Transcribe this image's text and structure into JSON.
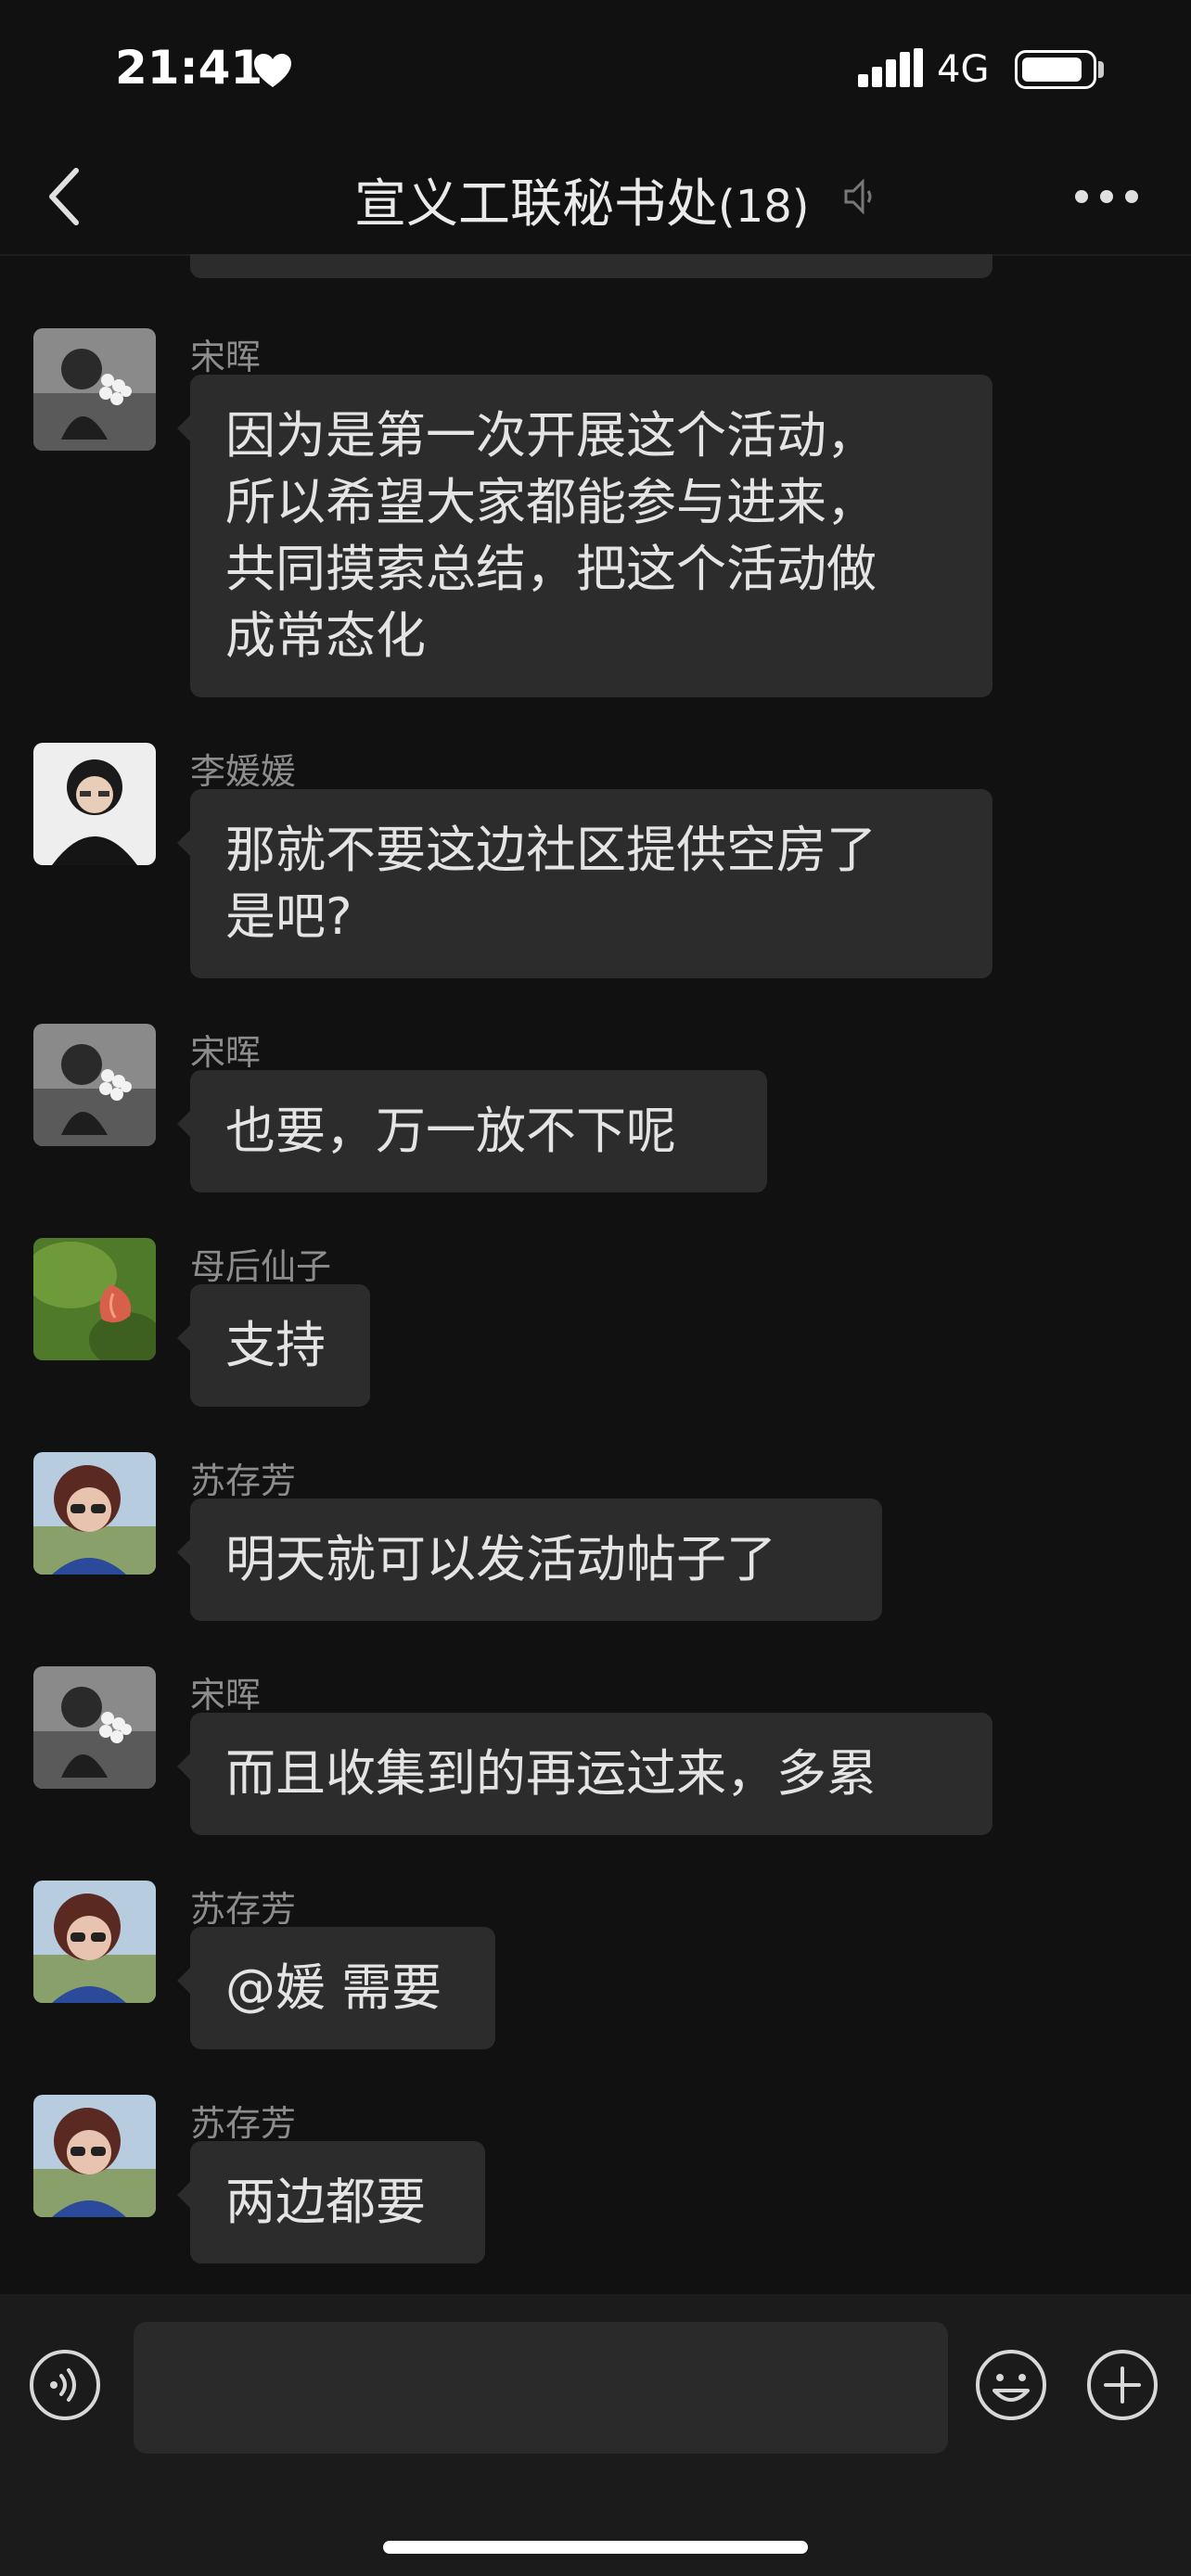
{
  "status_bar": {
    "time": "21:41",
    "network": "4G"
  },
  "header": {
    "title": "宣义工联秘书处",
    "member_count": "(18)"
  },
  "messages": [
    {
      "sender": "宋晖",
      "avatar": "girl-with-flowers",
      "lines": [
        "因为是第一次开展这个活动，",
        "所以希望大家都能参与进来，",
        "共同摸索总结，把这个活动做",
        "成常态化"
      ]
    },
    {
      "sender": "李媛媛",
      "avatar": "woman-portrait",
      "lines": [
        "那就不要这边社区提供空房了",
        "是吧?"
      ]
    },
    {
      "sender": "宋晖",
      "avatar": "girl-with-flowers",
      "lines": [
        "也要，万一放不下呢"
      ]
    },
    {
      "sender": "母后仙子",
      "avatar": "lotus-flower",
      "lines": [
        "支持"
      ]
    },
    {
      "sender": "苏存芳",
      "avatar": "woman-sunglasses",
      "lines": [
        "明天就可以发活动帖子了"
      ]
    },
    {
      "sender": "宋晖",
      "avatar": "girl-with-flowers",
      "lines": [
        "而且收集到的再运过来，多累"
      ]
    },
    {
      "sender": "苏存芳",
      "avatar": "woman-sunglasses",
      "lines": [
        "@媛 需要"
      ]
    },
    {
      "sender": "苏存芳",
      "avatar": "woman-sunglasses",
      "lines": [
        "两边都要"
      ]
    }
  ],
  "input": {
    "value": ""
  },
  "icons": {
    "back": "chevron-left-icon",
    "more": "more-dots-icon",
    "voice": "voice-icon",
    "emoji": "emoji-icon",
    "plus": "plus-icon",
    "mute": "mute-icon"
  }
}
